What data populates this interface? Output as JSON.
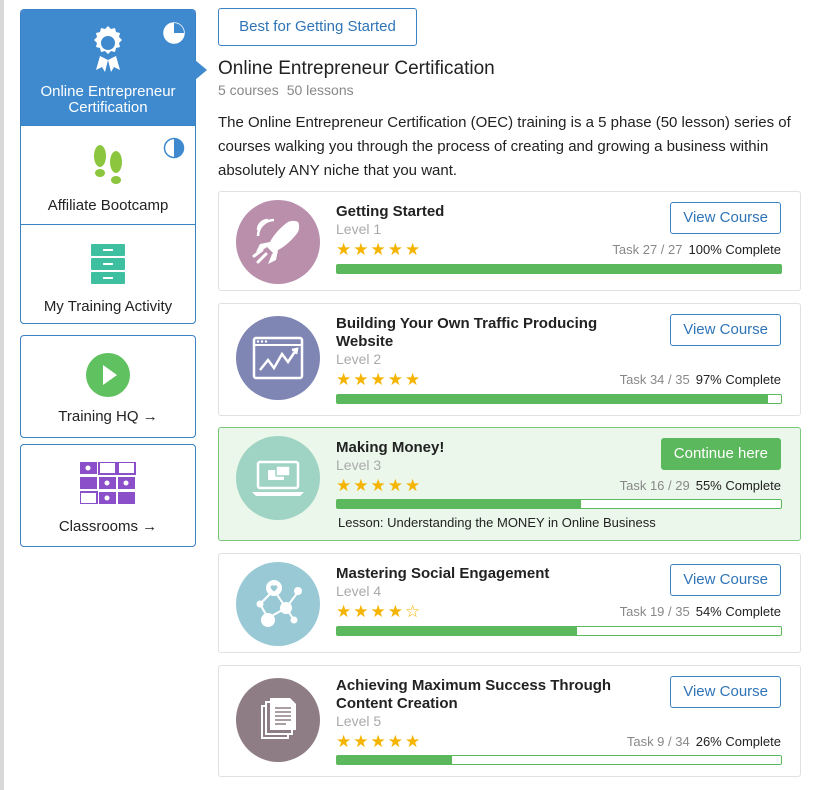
{
  "sidebar": {
    "items": [
      {
        "label": "Online Entrepreneur Certification"
      },
      {
        "label": "Affiliate Bootcamp"
      },
      {
        "label": "My Training Activity"
      }
    ],
    "training_hq": "Training HQ →",
    "classrooms": "Classrooms →"
  },
  "chip": "Best for Getting Started",
  "page": {
    "title": "Online Entrepreneur Certification",
    "courses": "5 courses",
    "lessons": "50 lessons",
    "description": "The Online Entrepreneur Certification (OEC) training is a 5 phase (50 lesson) series of courses walking you through the process of creating and growing a business within absolutely ANY niche that you want."
  },
  "courses": [
    {
      "title": "Getting Started",
      "level": "Level 1",
      "stars": "★★★★★",
      "task": "Task 27 / 27",
      "complete": "100% Complete",
      "progress": 1.0,
      "button": "View Course",
      "avatar_color": "#b98fac"
    },
    {
      "title": "Building Your Own Traffic Producing Website",
      "level": "Level 2",
      "stars": "★★★★★",
      "task": "Task 34 / 35",
      "complete": "97% Complete",
      "progress": 0.97,
      "button": "View Course",
      "avatar_color": "#8086b4"
    },
    {
      "title": "Making Money!",
      "level": "Level 3",
      "stars": "★★★★★",
      "task": "Task 16 / 29",
      "complete": "55% Complete",
      "progress": 0.55,
      "button": "Continue here",
      "lesson": "Lesson: Understanding the MONEY in Online Business",
      "avatar_color": "#9fd3c3"
    },
    {
      "title": "Mastering Social Engagement",
      "level": "Level 4",
      "stars": "★★★★☆",
      "task": "Task 19 / 35",
      "complete": "54% Complete",
      "progress": 0.54,
      "button": "View Course",
      "avatar_color": "#9ac9d6"
    },
    {
      "title": "Achieving Maximum Success Through Content Creation",
      "level": "Level 5",
      "stars": "★★★★★",
      "task": "Task 9 / 34",
      "complete": "26% Complete",
      "progress": 0.26,
      "button": "View Course",
      "avatar_color": "#8f7d85"
    }
  ],
  "colors": {
    "accent": "#3f8ace",
    "success": "#5cb85c",
    "star": "#f5b400"
  }
}
